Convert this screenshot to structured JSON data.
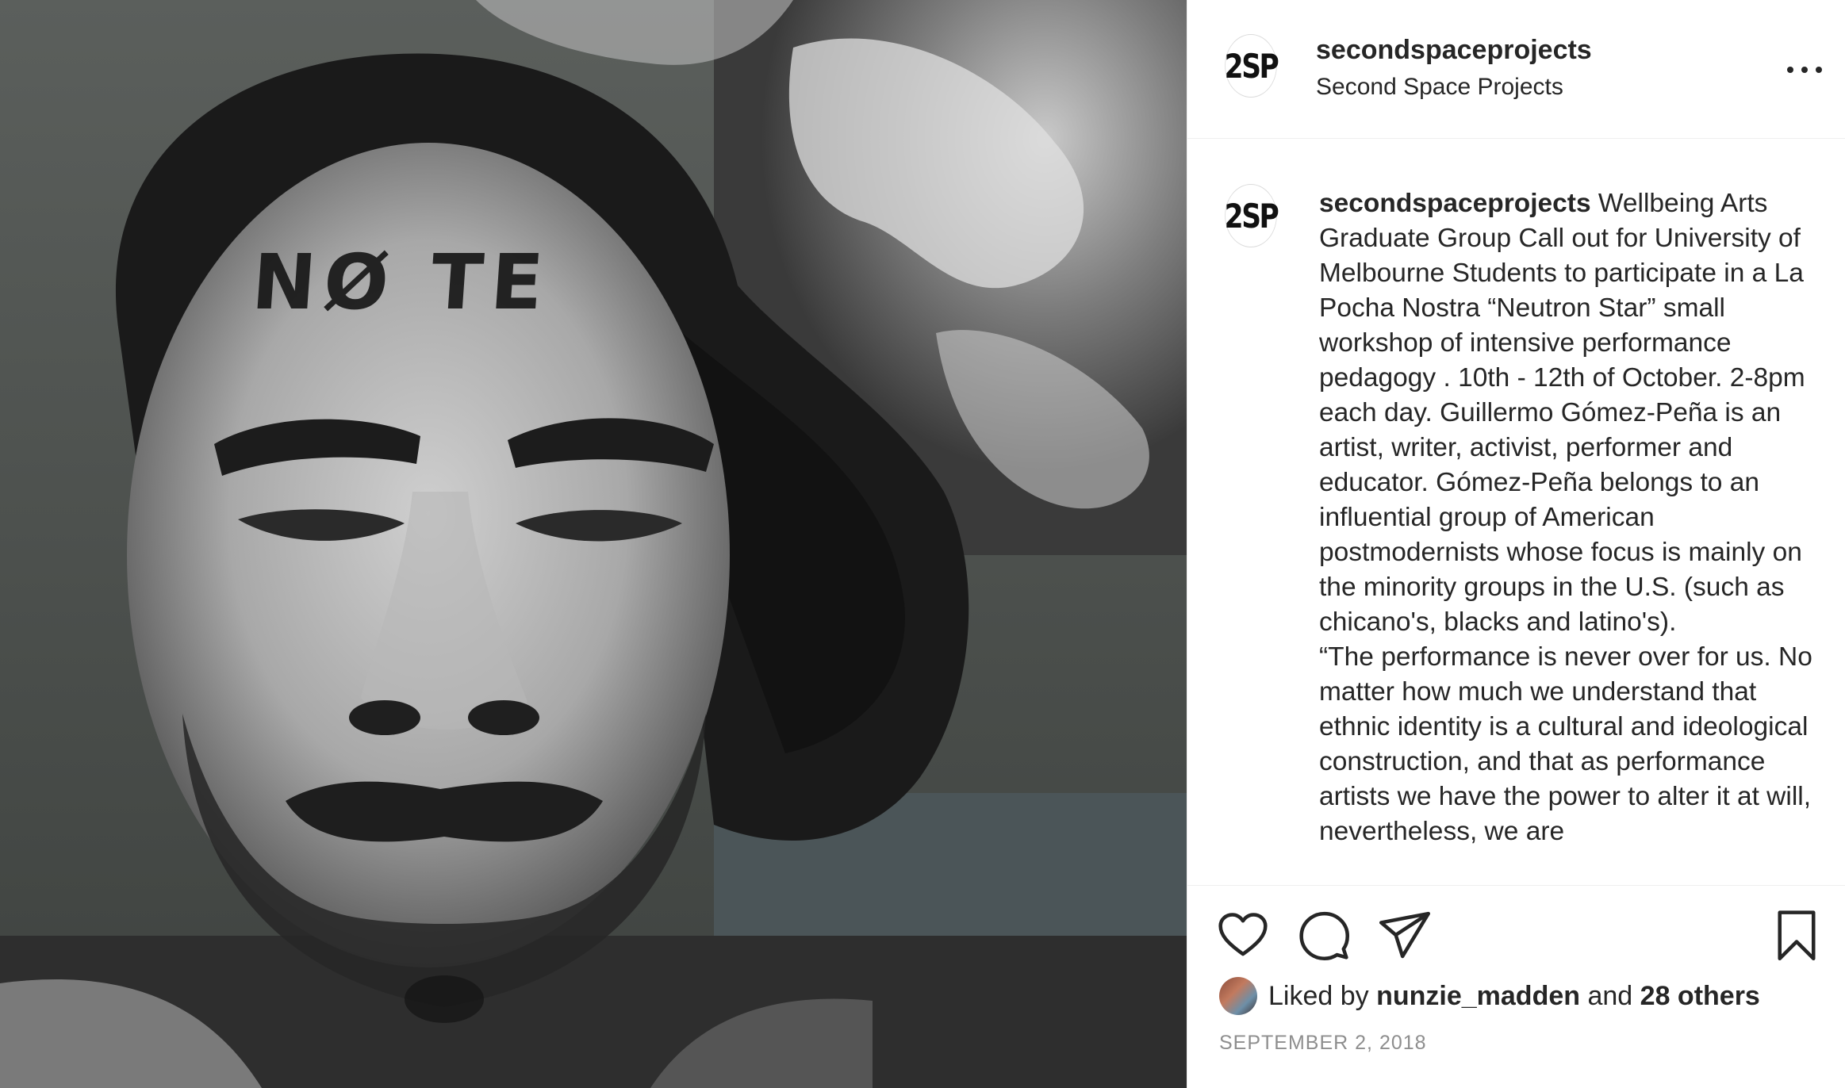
{
  "post_image": {
    "alt": "",
    "forehead_text": "NØ  TE"
  },
  "header": {
    "avatar_text": "2SP",
    "username": "secondspaceprojects",
    "full_name": "Second Space Projects"
  },
  "caption": {
    "avatar_text": "2SP",
    "username": "secondspaceprojects",
    "text": " Wellbeing Arts Graduate Group Call out for University of Melbourne Students to participate in a La Pocha Nostra “Neutron Star” small workshop of intensive performance pedagogy . 10th - 12th of October. 2-8pm each day. Guillermo Gómez-Peña is an artist, writer, activist, performer and educator. Gómez-Peña belongs to an influential group of American postmodernists whose focus is mainly on the minority groups in the U.S. (such as chicano's, blacks and latino's).\n“The performance is never over for us. No matter how much we understand that ethnic identity is a cultural and ideological construction, and that as performance artists we have the power to alter it at will, nevertheless, we are"
  },
  "actions": {
    "icons": [
      "heart-icon",
      "comment-icon",
      "share-icon",
      "bookmark-icon"
    ]
  },
  "likes": {
    "prefix": "Liked by",
    "liker": "nunzie_madden",
    "middle": "and",
    "others": "28 others"
  },
  "date": "SEPTEMBER 2, 2018"
}
